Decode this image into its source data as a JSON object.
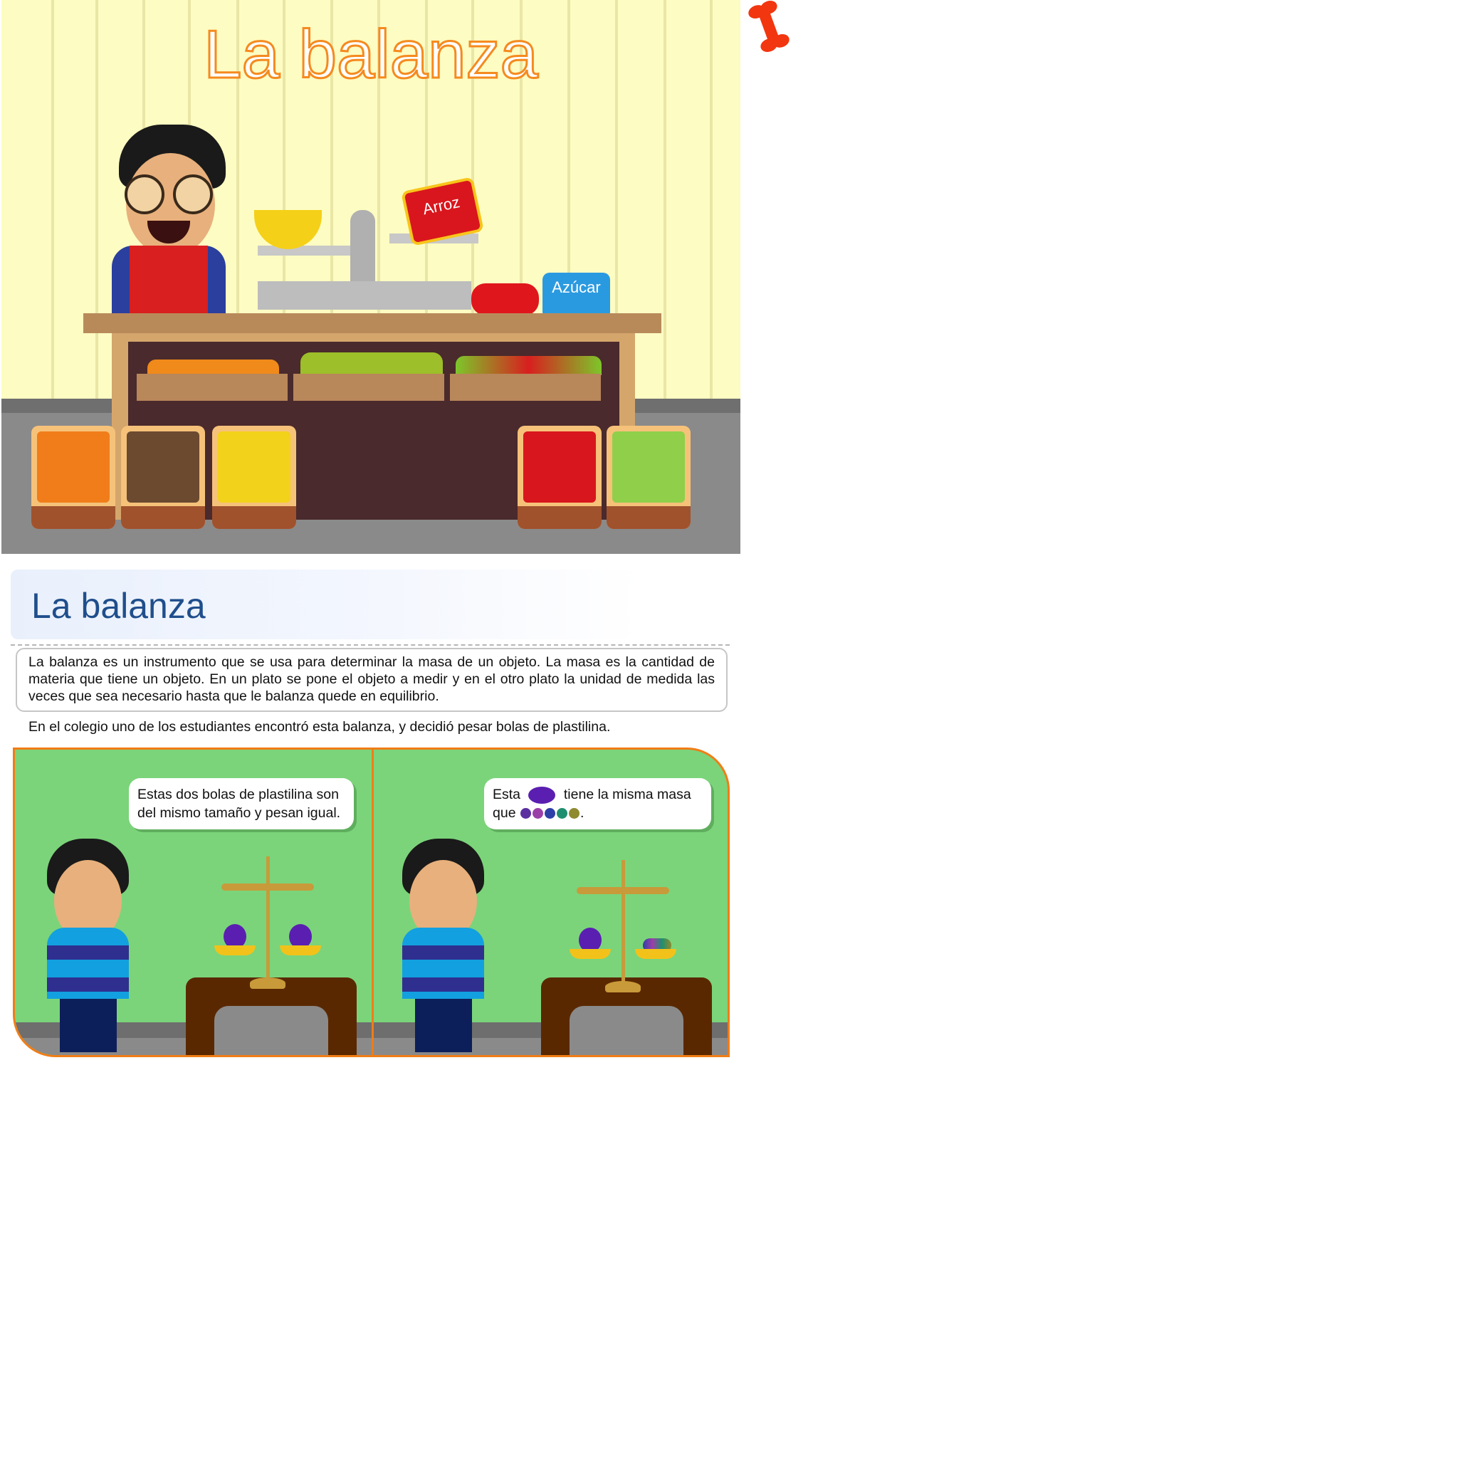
{
  "scene": {
    "title": "La balanza",
    "rice_label": "Arroz",
    "sugar_label": "Azúcar"
  },
  "header": {
    "title": "La balanza"
  },
  "definition": "La balanza es un instrumento que se usa para determinar la masa de un objeto. La masa es la cantidad de materia que tiene un objeto. En un plato se pone el objeto a medir y en el otro plato la unidad de medida las veces que sea necesario hasta que le balanza quede en equilibrio.",
  "intro": "En el colegio uno de los estudiantes encontró esta balanza, y decidió pesar bolas de plastilina.",
  "comic": {
    "panel1_text": "Estas dos bolas de plastilina son del mismo tamaño y pesan igual.",
    "panel2_text_a": "Esta",
    "panel2_text_b": "tiene la misma masa",
    "panel2_text_c": "que",
    "panel2_text_d": ".",
    "small_ball_colors": [
      "#5b2fa0",
      "#9b3fa8",
      "#2f3fa8",
      "#1f8f6f",
      "#8f8a2f"
    ],
    "big_ball_color": "#5a1fb0"
  },
  "colors": {
    "accent_orange": "#f07d16",
    "title_blue": "#1f4e8c",
    "panel_green": "#7bd47a"
  }
}
